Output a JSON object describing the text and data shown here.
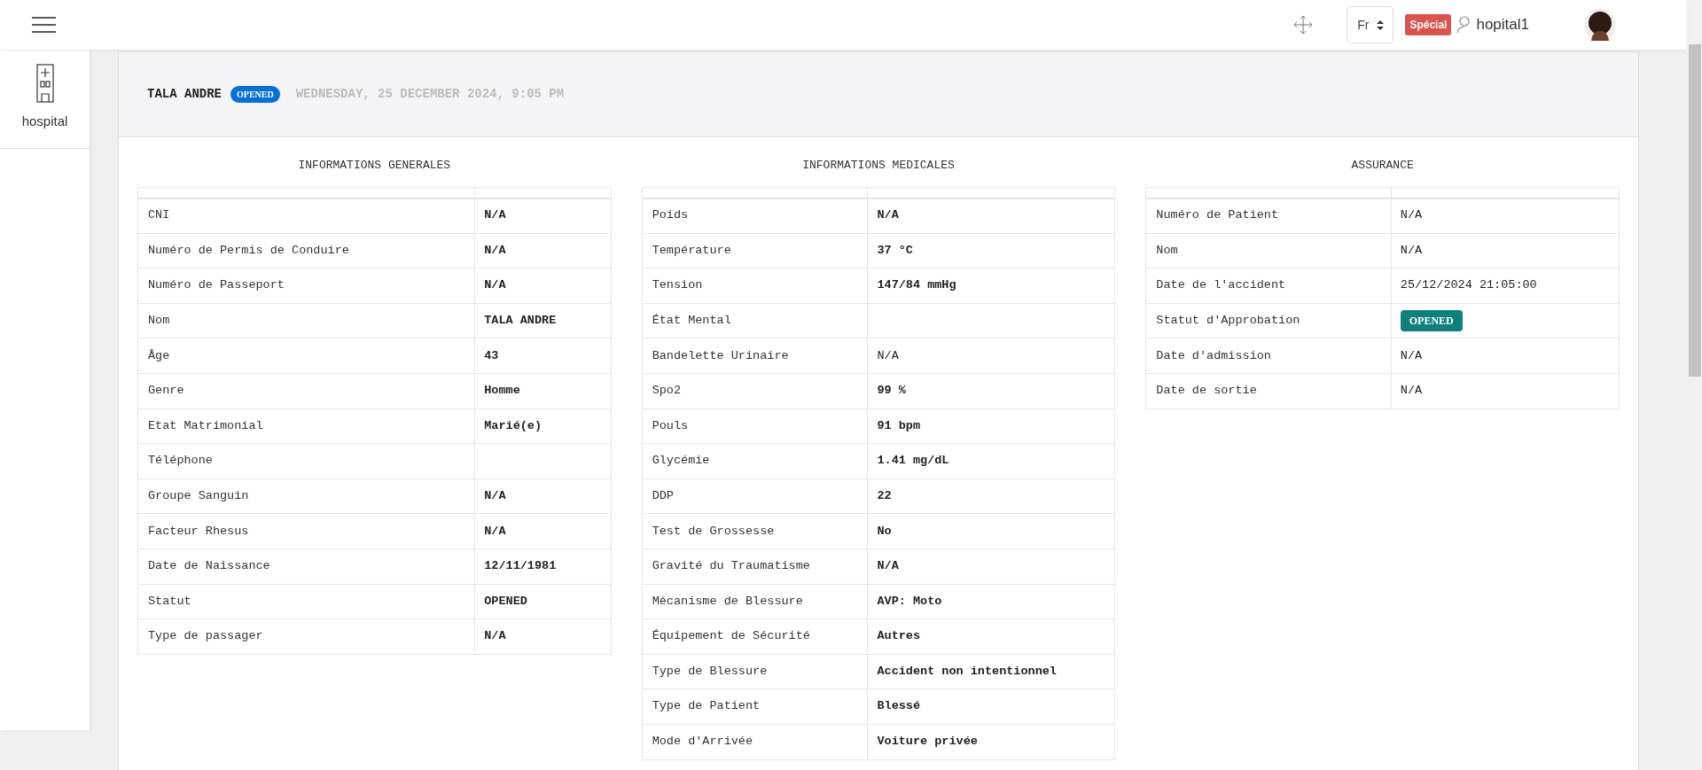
{
  "topbar": {
    "language": "Fr",
    "badge": "Spécial",
    "user": "hopital1"
  },
  "sidebar": {
    "items": [
      {
        "label": "hospital",
        "selected": false
      }
    ]
  },
  "header": {
    "patient": "TALA ANDRE",
    "status": "OPENED",
    "date": "WEDNESDAY, 25 DECEMBER 2024, 9:05 PM"
  },
  "sections": [
    {
      "title": "INFORMATIONS GENERALES",
      "rows": [
        {
          "label": "CNI",
          "value": "N/A",
          "bold": true
        },
        {
          "label": "Numéro de Permis de Conduire",
          "value": "N/A",
          "bold": true
        },
        {
          "label": "Numéro de Passeport",
          "value": "N/A",
          "bold": true
        },
        {
          "label": "Nom",
          "value": "TALA ANDRE",
          "bold": true
        },
        {
          "label": "Âge",
          "value": "43",
          "bold": true
        },
        {
          "label": "Genre",
          "value": "Homme",
          "bold": true
        },
        {
          "label": "Etat Matrimonial",
          "value": "Marié(e)",
          "bold": true
        },
        {
          "label": "Téléphone"
        },
        {
          "label": "Groupe Sanguin",
          "value": "N/A",
          "bold": true
        },
        {
          "label": "Facteur Rhesus",
          "value": "N/A",
          "bold": true
        },
        {
          "label": "Date de Naissance",
          "value": "12/11/1981",
          "bold": true
        },
        {
          "label": "Statut",
          "value": "OPENED",
          "bold": true
        },
        {
          "label": "Type de passager",
          "value": "N/A",
          "bold": true
        }
      ]
    },
    {
      "title": "INFORMATIONS MEDICALES",
      "rows": [
        {
          "label": "Poids",
          "value": "N/A",
          "bold": true
        },
        {
          "label": "Température",
          "value": "37 °C",
          "bold": true
        },
        {
          "label": "Tension",
          "value": "147/84 mmHg",
          "bold": true
        },
        {
          "label": "État Mental"
        },
        {
          "label": "Bandelette Urinaire",
          "value": "N/A",
          "bold": false
        },
        {
          "label": "Spo2",
          "value": "99 %",
          "bold": true
        },
        {
          "label": "Pouls",
          "value": "91 bpm",
          "bold": true
        },
        {
          "label": "Glycémie",
          "value": "1.41 mg/dL",
          "bold": true
        },
        {
          "label": "DDP",
          "value": "22",
          "bold": true
        },
        {
          "label": "Test de Grossesse",
          "value": "No",
          "bold": true
        },
        {
          "label": "Gravité du Traumatisme",
          "value": "N/A",
          "bold": true
        },
        {
          "label": "Mécanisme de Blessure",
          "value": "AVP: Moto",
          "bold": true
        },
        {
          "label": "Équipement de Sécurité",
          "value": "Autres",
          "bold": true
        },
        {
          "label": "Type de Blessure",
          "value": "Accident non intentionnel",
          "bold": true
        },
        {
          "label": "Type de Patient",
          "value": "Blessé",
          "bold": true
        },
        {
          "label": "Mode d'Arrivée",
          "value": "Voiture privée",
          "bold": true
        }
      ]
    },
    {
      "title": "ASSURANCE",
      "rows": [
        {
          "label": "Numéro de Patient",
          "value": "N/A",
          "bold": false
        },
        {
          "label": "Nom",
          "value": "N/A",
          "bold": false
        },
        {
          "label": "Date de l'accident",
          "value": "25/12/2024 21:05:00",
          "bold": false
        },
        {
          "label": "Statut d'Approbation",
          "value": "OPENED",
          "kind": "badge",
          "bold": true
        },
        {
          "label": "Date d'admission",
          "value": "N/A",
          "bold": false
        },
        {
          "label": "Date de sortie",
          "value": "N/A",
          "bold": false
        }
      ]
    }
  ]
}
